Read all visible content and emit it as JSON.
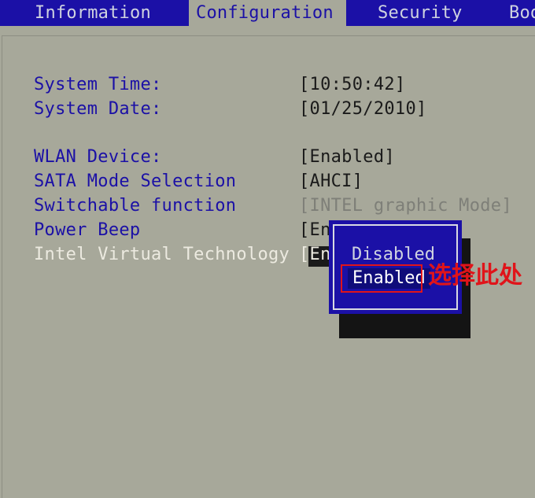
{
  "tabs": [
    {
      "label": "Information"
    },
    {
      "label": "Configuration"
    },
    {
      "label": "Security"
    },
    {
      "label": "Boo"
    }
  ],
  "settings": {
    "system_time": {
      "label": "System Time:",
      "value": "[10:50:42]"
    },
    "system_date": {
      "label": "System Date:",
      "value": "[01/25/2010]"
    },
    "wlan": {
      "label": "WLAN Device:",
      "value": "[Enabled]"
    },
    "sata": {
      "label": "SATA Mode Selection",
      "value": "[AHCI]"
    },
    "switchable": {
      "label": "Switchable function",
      "value": "[INTEL graphic Mode]"
    },
    "power_beep": {
      "label": "Power Beep",
      "value": "[En"
    },
    "intel_vt": {
      "label": "Intel Virtual Technology",
      "value": "[En"
    }
  },
  "popup": {
    "options": [
      "Disabled",
      "Enabled"
    ],
    "selected": "Enabled"
  },
  "annotation": "选择此处",
  "colors": {
    "bios_blue": "#1b10a6",
    "bios_grey": "#a7a89a",
    "annotation_red": "#e0141a"
  }
}
